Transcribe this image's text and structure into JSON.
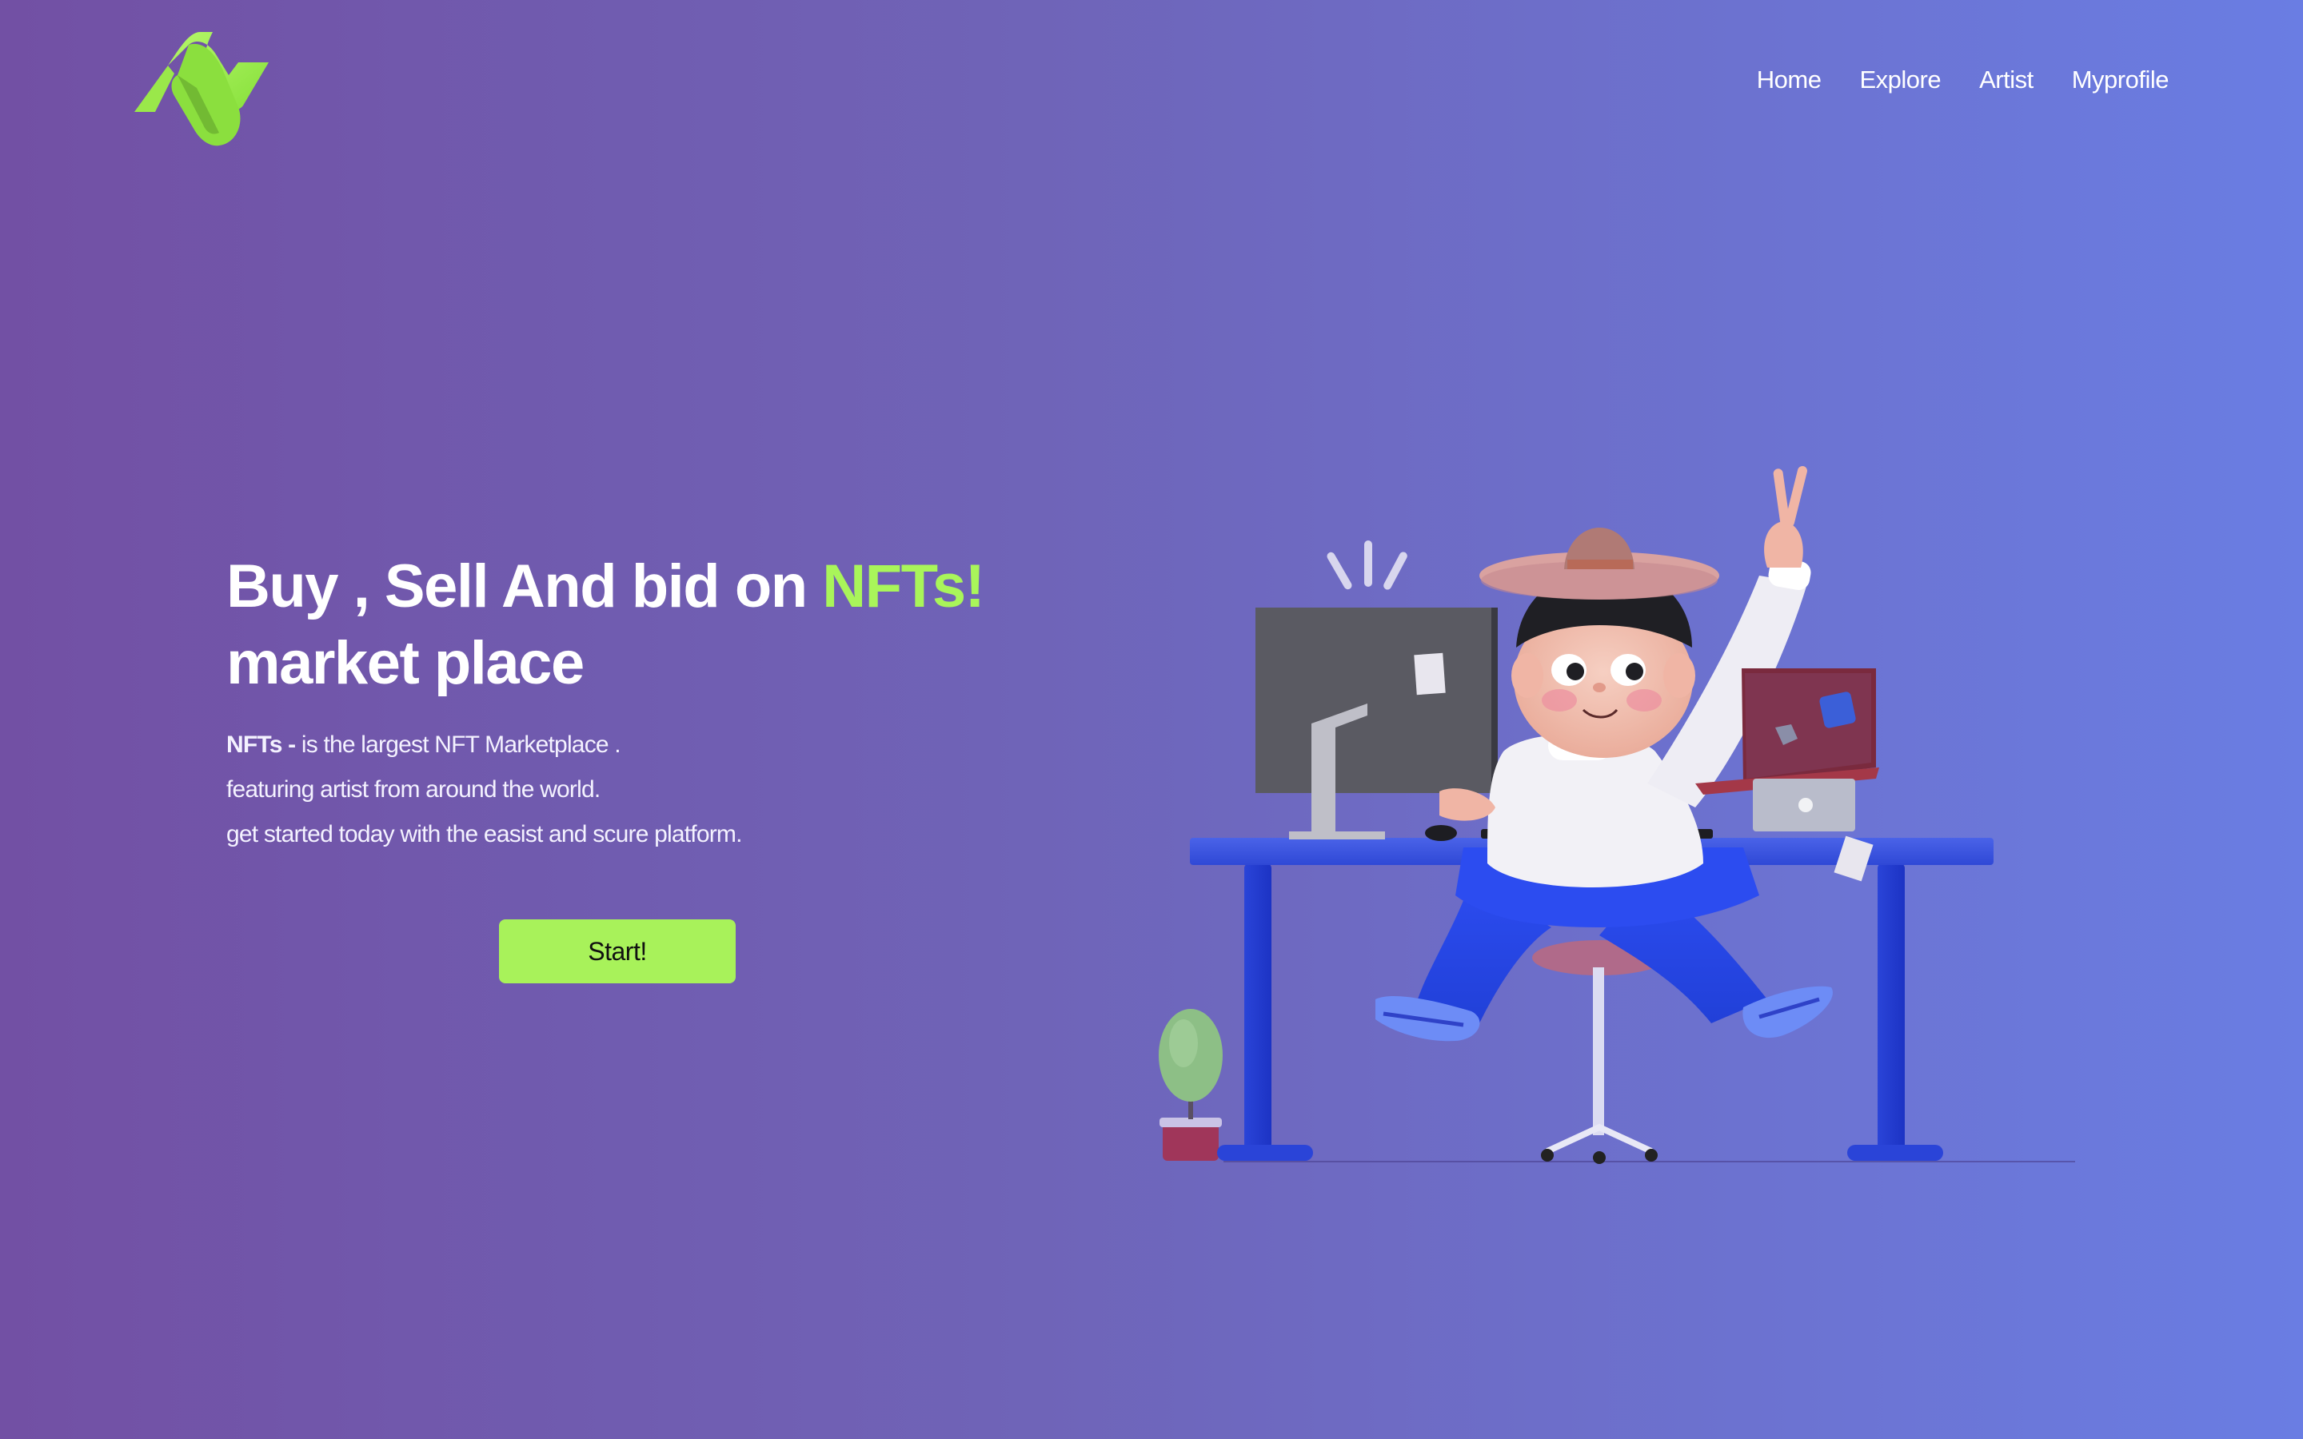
{
  "brand": {
    "logo_icon": "zigzag-n-logo",
    "accent_color": "#a9f55a"
  },
  "nav": {
    "items": [
      {
        "label": "Home"
      },
      {
        "label": "Explore"
      },
      {
        "label": "Artist"
      },
      {
        "label": "Myprofile"
      }
    ]
  },
  "hero": {
    "headline_part1": "Buy , Sell And bid on ",
    "headline_accent": "NFTs!",
    "headline_line2": "market place",
    "desc_bold": "NFTs - ",
    "desc_line1": "is the largest NFT Marketplace .",
    "desc_line2": "featuring artist from around the world.",
    "desc_line3": "get started today with the easist and scure platform.",
    "cta_label": "Start!"
  },
  "illustration": {
    "icon": "person-at-desk-illustration"
  },
  "colors": {
    "background_start": "#7250a4",
    "background_end": "#6a7de3",
    "button": "#a8f25a"
  }
}
